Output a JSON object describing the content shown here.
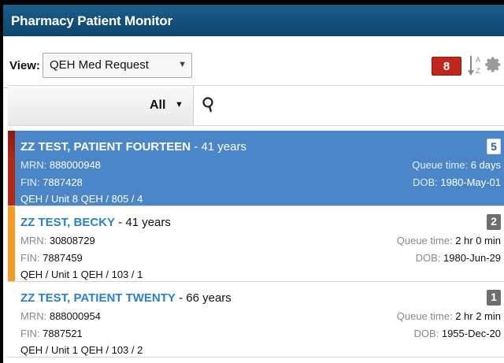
{
  "app": {
    "title": "Pharmacy Patient Monitor"
  },
  "toolbar": {
    "view_label": "View:",
    "view_selected": "QEH Med Request",
    "alert_count": "8",
    "badge_color": "#c0271c",
    "sort_icon": "sort-alpha-icon",
    "settings_icon": "gear-icon"
  },
  "filter": {
    "selected": "All",
    "search_icon": "search-icon"
  },
  "patients": [
    {
      "name": "ZZ TEST, PATIENT FOURTEEN",
      "age": " - 41 years",
      "mrn_label": "MRN: ",
      "mrn": "888000948",
      "fin_label": "FIN: ",
      "fin": "7887428",
      "location": "QEH / Unit 8 QEH / 805 / 4",
      "count": "5",
      "queue_label": "Queue time: ",
      "queue": "6 days",
      "dob_label": "DOB: ",
      "dob": "1980-May-01",
      "selected": true,
      "bar_color": "#b22a14",
      "bar_top_color": "#8a1a0a"
    },
    {
      "name": "ZZ TEST, BECKY",
      "age": " - 41 years",
      "mrn_label": "MRN: ",
      "mrn": "30808729",
      "fin_label": "FIN: ",
      "fin": "7887459",
      "location": "QEH / Unit 1 QEH / 103 / 1",
      "count": "2",
      "queue_label": "Queue time: ",
      "queue": "2 hr 0 min",
      "dob_label": "DOB: ",
      "dob": "1980-Jun-29",
      "selected": false,
      "bar_color": "#f59a23"
    },
    {
      "name": "ZZ TEST, PATIENT TWENTY",
      "age": " - 66 years",
      "mrn_label": "MRN: ",
      "mrn": "888000954",
      "fin_label": "FIN: ",
      "fin": "7887521",
      "location": "QEH / Unit 1 QEH / 103 / 2",
      "count": "1",
      "queue_label": "Queue time: ",
      "queue": "2 hr 2 min",
      "dob_label": "DOB: ",
      "dob": "1955-Dec-20",
      "selected": false,
      "bar_color": ""
    }
  ]
}
